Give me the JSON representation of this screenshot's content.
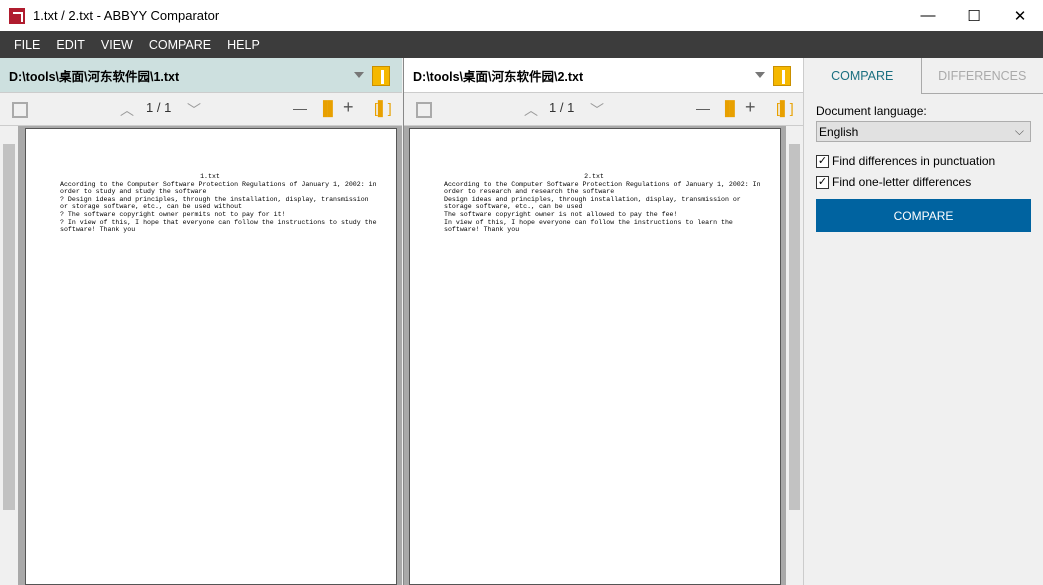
{
  "window": {
    "title": "1.txt / 2.txt - ABBYY Comparator",
    "controls": [
      "—",
      "☐",
      "✕"
    ]
  },
  "menu": [
    "FILE",
    "EDIT",
    "VIEW",
    "COMPARE",
    "HELP"
  ],
  "left": {
    "path": "D:\\tools\\桌面\\河东软件园\\1.txt",
    "page": "1 / 1",
    "doc": {
      "title": "1.txt",
      "lines": [
        "According to the Computer Software Protection Regulations of January 1, 2002: in",
        "order to study and study the software",
        "? Design ideas and principles, through the installation, display, transmission",
        "or storage software, etc., can be used without",
        "? The software copyright owner permits not to pay for it!",
        "? In view of this, I hope that everyone can follow the instructions to study the",
        "software! Thank you"
      ]
    }
  },
  "right": {
    "path": "D:\\tools\\桌面\\河东软件园\\2.txt",
    "page": "1 / 1",
    "doc": {
      "title": "2.txt",
      "lines": [
        "According to the Computer Software Protection Regulations of January 1, 2002: In",
        "order to research and research the software",
        "Design ideas and principles, through installation, display, transmission or",
        "storage software, etc., can be used",
        "The software copyright owner is not allowed to pay the fee!",
        "In view of this, I hope everyone can follow the instructions to learn the",
        "software! Thank you"
      ]
    }
  },
  "side": {
    "tabs": [
      "COMPARE",
      "DIFFERENCES"
    ],
    "language_label": "Document language:",
    "language": "English",
    "options": [
      {
        "label": "Find differences in punctuation",
        "checked": true
      },
      {
        "label": "Find one-letter differences",
        "checked": true
      }
    ],
    "compare_button": "COMPARE"
  },
  "colors": {
    "accent": "#0063a0",
    "selected_header": "#cde0df",
    "menubar": "#3c3c3c"
  }
}
